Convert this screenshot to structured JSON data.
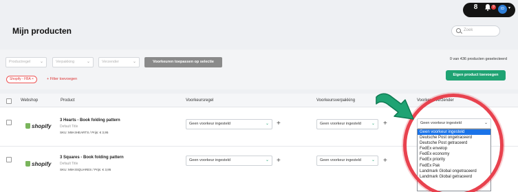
{
  "topbar": {
    "logo_glyph": "8",
    "notif_count": "9",
    "avatar_initials": "ID"
  },
  "page": {
    "title": "Mijn producten"
  },
  "search": {
    "placeholder": "Zoek"
  },
  "filters": {
    "select1": "Productregel",
    "select2": "Verpakking",
    "select3": "Verzender",
    "apply_label": "Voorkeuren toepassen op selectie",
    "selection_count": "0 van 436 producten geselecteerd",
    "add_product_label": "Eigen product toevoegen",
    "active_tag": "Shopify - FBA",
    "add_filter_label": "+ Filter toevoegen"
  },
  "table": {
    "headers": {
      "webshop": "Webshop",
      "product": "Product",
      "rule": "Voorkeursregel",
      "packaging": "Voorkeursverpakking",
      "carrier": "Voorkeursverzender"
    },
    "rows": [
      {
        "shop": "shopify",
        "name": "3 Hearts - Book folding pattern",
        "sub": "Default Title",
        "sku": "SKU: MM-3HEARTS / Prijs: € 3,95",
        "rule": "Geen voorkeur ingesteld",
        "packaging": "Geen voorkeur ingesteld",
        "carrier": "Geen voorkeur ingesteld"
      },
      {
        "shop": "shopify",
        "name": "3 Squares - Book folding pattern",
        "sub": "Default Title",
        "sku": "SKU: MM-3SQUARES / Prijs: € 3,95",
        "rule": "Geen voorkeur ingesteld",
        "packaging": "Geen voorkeur ingesteld"
      }
    ]
  },
  "carrier_options": [
    "Geen voorkeur ingesteld",
    "Deutsche Post ongetraceerd",
    "Deutsche Post getraceerd",
    "FedEx envelop",
    "FedEx economy",
    "FedEx priority",
    "FedEx Pak",
    "Landmark Global ongetraceerd",
    "Landmark Global getraceerd"
  ],
  "colors": {
    "accent": "#1fa373",
    "highlight_circle": "#e8424e",
    "selected_option": "#1a73e8"
  },
  "icons": [
    "logo-icon",
    "bell-icon",
    "avatar",
    "chevron-down-icon",
    "search-icon",
    "close-icon",
    "shopify-icon",
    "plus-icon",
    "pointing-hand-icon"
  ]
}
